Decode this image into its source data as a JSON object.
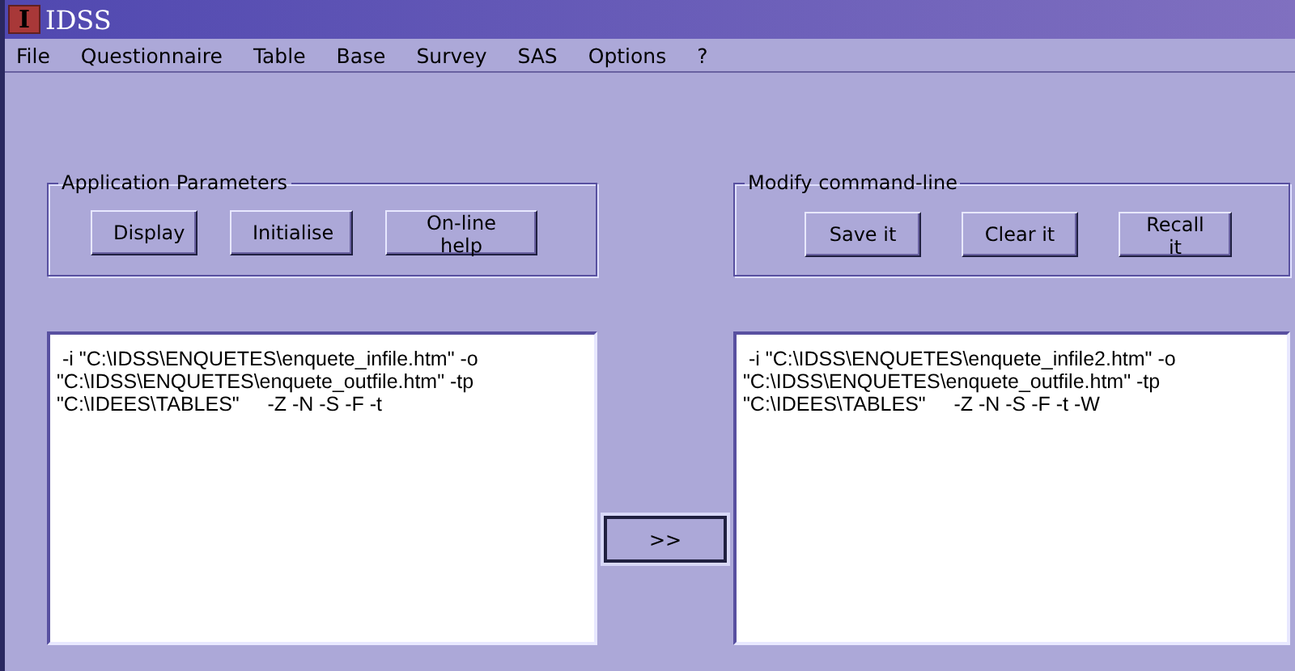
{
  "window": {
    "icon_letter": "I",
    "title": "IDSS"
  },
  "menu": [
    "File",
    "Questionnaire",
    "Table",
    "Base",
    "Survey",
    "SAS",
    "Options",
    "?"
  ],
  "left_group": {
    "title": "Application Parameters",
    "buttons": [
      "Display",
      "Initialise",
      "On-line help"
    ]
  },
  "right_group": {
    "title": "Modify command-line",
    "buttons": [
      "Save it",
      "Clear it",
      "Recall it"
    ]
  },
  "left_text": [
    " -i \"C:\\IDSS\\ENQUETES\\enquete_infile.htm\" -o",
    "\"C:\\IDSS\\ENQUETES\\enquete_outfile.htm\" -tp",
    "\"C:\\IDEES\\TABLES\"     -Z -N -S -F -t"
  ],
  "copy_button": ">>",
  "right_text": [
    " -i \"C:\\IDSS\\ENQUETES\\enquete_infile2.htm\" -o",
    "\"C:\\IDSS\\ENQUETES\\enquete_outfile.htm\" -tp",
    "\"C:\\IDEES\\TABLES\"     -Z -N -S -F -t -W"
  ]
}
